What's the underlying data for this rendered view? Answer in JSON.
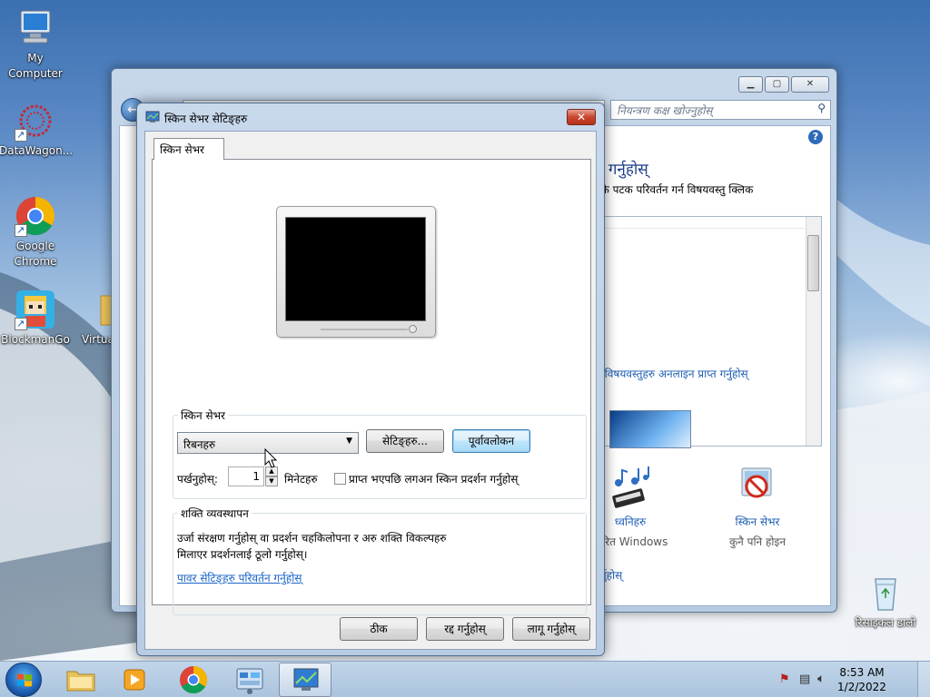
{
  "desktop": {
    "icons": [
      {
        "label": "My Computer"
      },
      {
        "label": "DataWagon..."
      },
      {
        "label": "Google Chrome"
      },
      {
        "label": "BlockmanGo"
      },
      {
        "label": "Virtua"
      },
      {
        "label": "रिसाइकल डालो"
      }
    ]
  },
  "control_panel": {
    "search_placeholder": "नियन्त्रण कक्ष खोज्नुहोस्",
    "heading": "न गर्नुहोस्",
    "subtext": "एकै पटक परिवर्तन गर्न विषयवस्तु क्लिक",
    "online_link": "प विषयवस्तुहरु अनलाइन प्राप्त गर्नुहोस्",
    "items": [
      {
        "label": "ध्वनिहरु",
        "sub": "धारित Windows",
        "icon": "music-notes-icon"
      },
      {
        "label": "स्किन सेभर",
        "sub": "कुनै पनि होइन",
        "icon": "no-screensaver-icon"
      }
    ],
    "bottom_link": "र्नुहोस्"
  },
  "dialog": {
    "title": "स्किन सेभर सेटिङ्हरु",
    "tab_label": "स्किन सेभर",
    "screensaver_group_label": "स्किन सेभर",
    "screensaver_selected": "रिबनहरु",
    "settings_button": "सेटिङ्हरु...",
    "preview_button": "पूर्वावलोकन",
    "wait_label": "पर्खनुहोस्:",
    "wait_value": "1",
    "minutes_label": "मिनेटहरु",
    "resume_checkbox_label": "प्राप्त भएपछि लगअन स्किन प्रदर्शन गर्नुहोस्",
    "resume_checked": false,
    "power_group_label": "शक्ति व्यवस्थापन",
    "power_text_line1": "उर्जा संरक्षण गर्नुहोस् वा प्रदर्शन चहकिलोपना र अरु शक्ति विकल्पहरु",
    "power_text_line2": "मिलाएर प्रदर्शनलाई ठूलो गर्नुहोस्।",
    "power_link": "पावर सेटिङ्हरु परिवर्तन गर्नुहोस्",
    "ok_button": "ठीक",
    "cancel_button": "रद्द गर्नुहोस्",
    "apply_button": "लागू गर्नुहोस्"
  },
  "taskbar": {
    "buttons": [
      "start-orb",
      "file-explorer",
      "media-player",
      "google-chrome",
      "control-panel",
      "screen-saver-settings"
    ],
    "active_index": 5,
    "clock_time": "8:53 AM",
    "clock_date": "1/2/2022",
    "tray_icons": [
      "action-center-flag-icon",
      "network-icon",
      "volume-icon"
    ]
  },
  "colors": {
    "link": "#1a65c7",
    "title_close": "#c9452d",
    "accent_blue": "#1e5fb4"
  }
}
